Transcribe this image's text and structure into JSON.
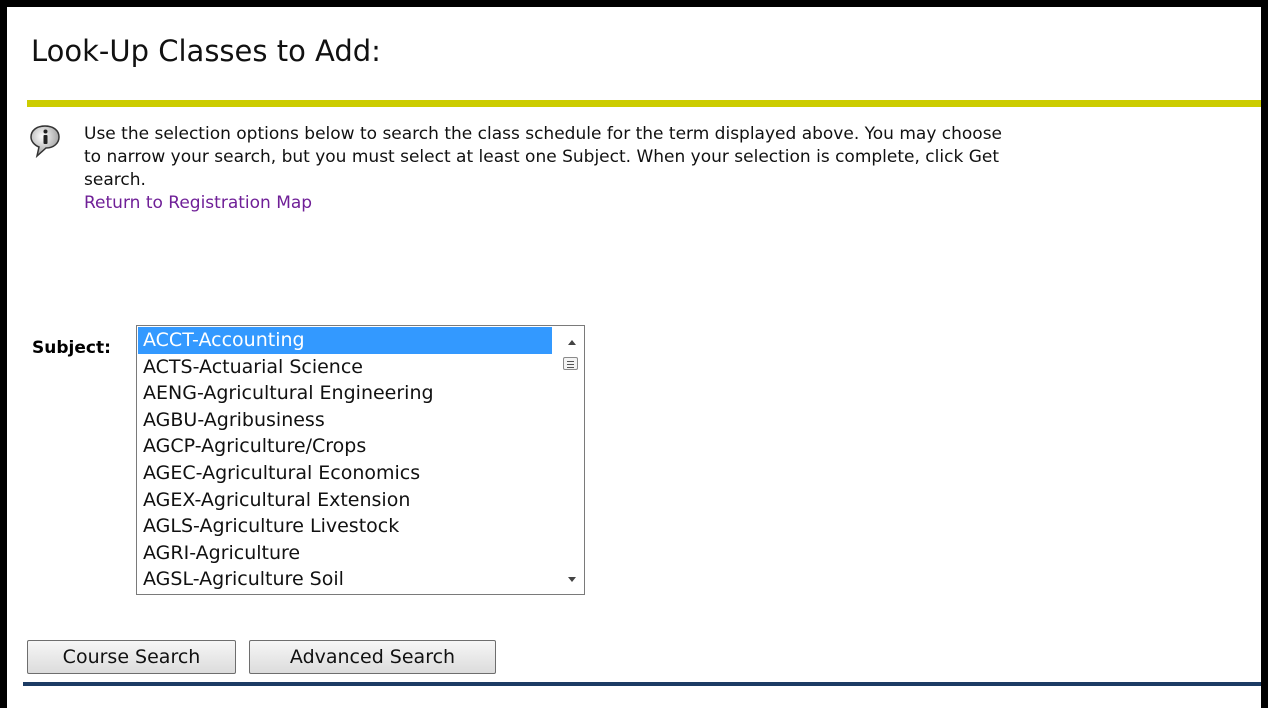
{
  "page": {
    "title": "Look-Up Classes to Add:"
  },
  "info": {
    "lines": [
      "Use the selection options below to search the class schedule for the term displayed above. You may choose",
      "to narrow your search, but you must select at least one Subject. When your selection is complete, click Get",
      "search."
    ],
    "link_text": "Return to Registration Map",
    "icon": "info-icon"
  },
  "subject": {
    "label": "Subject:",
    "selected": "ACCT-Accounting",
    "options": [
      "ACCT-Accounting",
      "ACTS-Actuarial Science",
      "AENG-Agricultural Engineering",
      "AGBU-Agribusiness",
      "AGCP-Agriculture/Crops",
      "AGEC-Agricultural Economics",
      "AGEX-Agricultural Extension",
      "AGLS-Agriculture Livestock",
      "AGRI-Agriculture",
      "AGSL-Agriculture Soil"
    ]
  },
  "buttons": {
    "course_search": "Course Search",
    "advanced_search": "Advanced Search"
  },
  "colors": {
    "title_rule": "#cccc00",
    "link": "#6f1f97",
    "selection": "#3399ff",
    "bottom_rule": "#1c3b64"
  }
}
